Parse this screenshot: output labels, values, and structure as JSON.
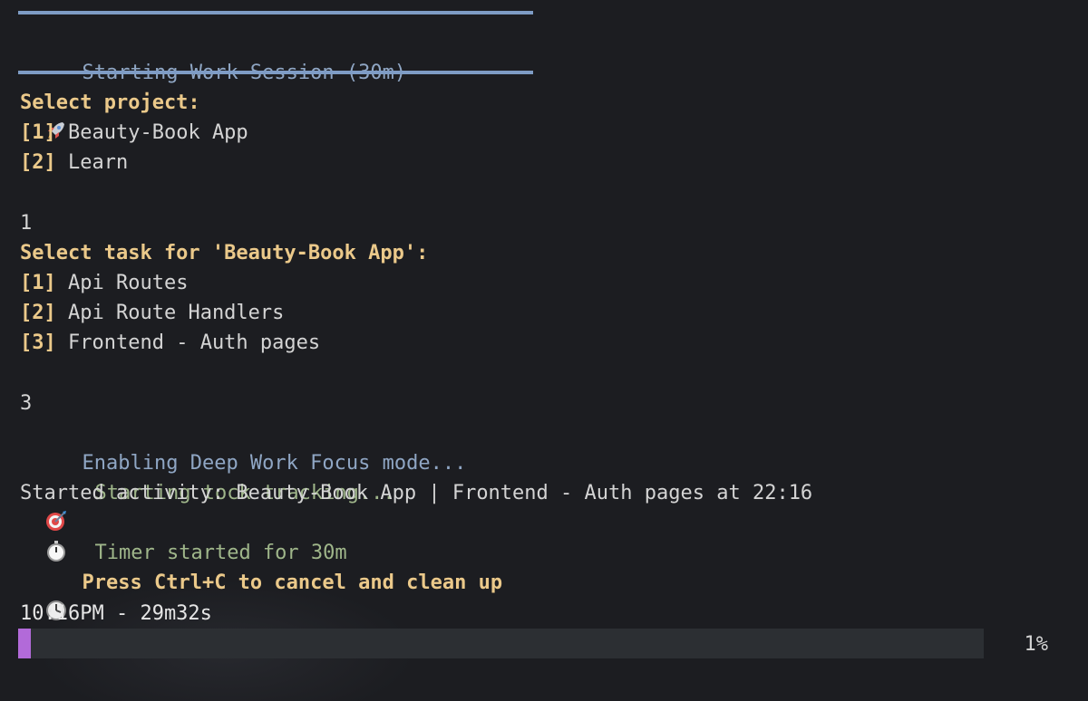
{
  "header": {
    "title": "Starting Work Session (30m)",
    "icon": "rocket-icon",
    "rule_color": "#7e9cc5"
  },
  "project_prompt": {
    "heading": "Select project:",
    "options": [
      {
        "key": "[1]",
        "label": "Beauty-Book App"
      },
      {
        "key": "[2]",
        "label": "Learn"
      }
    ],
    "input": "1"
  },
  "task_prompt": {
    "heading": "Select task for 'Beauty-Book App':",
    "options": [
      {
        "key": "[1]",
        "label": "Api Routes"
      },
      {
        "key": "[2]",
        "label": "Api Route Handlers"
      },
      {
        "key": "[3]",
        "label": "Frontend - Auth pages"
      }
    ],
    "input": "3"
  },
  "log": {
    "focus": {
      "icon": "target-icon",
      "text": "Enabling Deep Work Focus mode..."
    },
    "tracking": {
      "icon": "stopwatch-icon",
      "text": "Starting tock tracking..."
    },
    "started": "Started activity: Beauty-Book App | Frontend - Auth pages at 22:16",
    "timer": {
      "icon": "timer-clock-icon",
      "text": "Timer started for 30m"
    },
    "hint": {
      "icon": "lightbulb-icon",
      "text": "Press Ctrl+C to cancel and clean up"
    }
  },
  "progress": {
    "status": "10:16PM - 29m32s",
    "percent_label": "1%",
    "fraction": 0.013,
    "fill_color": "#b26ad9",
    "track_color": "#2c2f33"
  }
}
